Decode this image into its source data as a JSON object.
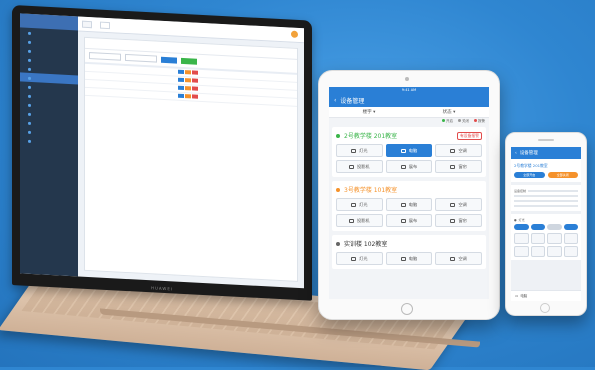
{
  "colors": {
    "brand": "#2a7fd6",
    "background": "#2f86d1",
    "alarm": "#e24c4c",
    "green": "#3ab54a",
    "orange": "#f5922b"
  },
  "laptop": {
    "brand_label": "HUAWEI",
    "sidebar_items": [
      {
        "label": "",
        "icon": "circle-icon",
        "active": false
      },
      {
        "label": "",
        "icon": "circle-icon",
        "active": false
      },
      {
        "label": "",
        "icon": "circle-icon",
        "active": false
      },
      {
        "label": "",
        "icon": "circle-icon",
        "active": false
      },
      {
        "label": "",
        "icon": "circle-icon",
        "active": false
      },
      {
        "label": "",
        "icon": "circle-icon",
        "active": true
      },
      {
        "label": "",
        "icon": "circle-icon",
        "active": false
      },
      {
        "label": "",
        "icon": "circle-icon",
        "active": false
      },
      {
        "label": "",
        "icon": "circle-icon",
        "active": false
      },
      {
        "label": "",
        "icon": "circle-icon",
        "active": false
      },
      {
        "label": "",
        "icon": "circle-icon",
        "active": false
      },
      {
        "label": "",
        "icon": "circle-icon",
        "active": false
      },
      {
        "label": "",
        "icon": "circle-icon",
        "active": false
      }
    ]
  },
  "tablet": {
    "status_time": "9:41 AM",
    "title": "设备管理",
    "filter_building": "楼宇",
    "filter_status": "状态",
    "legend": [
      {
        "label": "开启",
        "color": "#3ab54a"
      },
      {
        "label": "关闭",
        "color": "#999999"
      },
      {
        "label": "报警",
        "color": "#e24c4c"
      }
    ],
    "cards": [
      {
        "title": "2号教学楼 201教室",
        "dot": "#3ab54a",
        "title_color": "#3ab54a",
        "badge": "有设备报警",
        "devices": [
          {
            "label": "灯光",
            "on": false
          },
          {
            "label": "电脑",
            "on": true
          },
          {
            "label": "空调",
            "on": false
          },
          {
            "label": "投影机",
            "on": false
          },
          {
            "label": "展布",
            "on": false
          },
          {
            "label": "窗帘",
            "on": false
          }
        ]
      },
      {
        "title": "3号教学楼 101教室",
        "dot": "#f5922b",
        "title_color": "#f5922b",
        "badge": "",
        "devices": [
          {
            "label": "灯光",
            "on": false
          },
          {
            "label": "电脑",
            "on": false
          },
          {
            "label": "空调",
            "on": false
          },
          {
            "label": "投影机",
            "on": false
          },
          {
            "label": "展布",
            "on": false
          },
          {
            "label": "窗帘",
            "on": false
          }
        ]
      },
      {
        "title": "实训楼 102教室",
        "dot": "#666666",
        "title_color": "#333333",
        "badge": "",
        "devices": [
          {
            "label": "灯光",
            "on": false
          },
          {
            "label": "电脑",
            "on": false
          },
          {
            "label": "空调",
            "on": false
          }
        ]
      }
    ]
  },
  "phone": {
    "title": "设备管理",
    "room_title": "2号教学楼 201教室",
    "buttons": [
      {
        "label": "全部开启",
        "color": "#2a7fd6"
      },
      {
        "label": "全部关闭",
        "color": "#f5922b"
      }
    ],
    "section_label": "设备控制",
    "toggle_label": "灯光",
    "footer_label": "电脑"
  }
}
